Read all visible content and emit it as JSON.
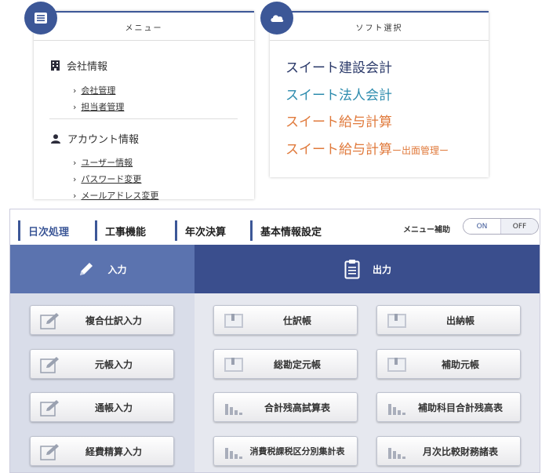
{
  "menu": {
    "title": "メニュー",
    "icon": "list-icon",
    "company": {
      "heading": "会社情報",
      "icon": "building-icon",
      "links": [
        "会社管理",
        "担当者管理"
      ]
    },
    "account": {
      "heading": "アカウント情報",
      "icon": "user-icon",
      "links": [
        "ユーザー情報",
        "パスワード変更",
        "メールアドレス変更"
      ]
    }
  },
  "software": {
    "title": "ソフト選択",
    "icon": "cloud-icon",
    "items": [
      {
        "label": "スイート建設会計",
        "suffix": "",
        "color": "#2b3a6a"
      },
      {
        "label": "スイート法人会計",
        "suffix": "",
        "color": "#2e8cae"
      },
      {
        "label": "スイート給与計算",
        "suffix": "",
        "color": "#e07a3c"
      },
      {
        "label": "スイート給与計算",
        "suffix": "ー出面管理ー",
        "color": "#e07a3c"
      }
    ]
  },
  "tabs": [
    {
      "label": "日次処理",
      "active": true
    },
    {
      "label": "工事機能",
      "active": false
    },
    {
      "label": "年次決算",
      "active": false
    },
    {
      "label": "基本情報設定",
      "active": false
    }
  ],
  "menu_assist": {
    "label": "メニュー補助",
    "on": "ON",
    "off": "OFF",
    "state": "ON"
  },
  "input_column": {
    "heading": "入力",
    "icon": "pencil-icon",
    "buttons": [
      "複合仕訳入力",
      "元帳入力",
      "通帳入力",
      "経費精算入力"
    ]
  },
  "output_column": {
    "heading": "出力",
    "icon": "clipboard-icon",
    "buttons": [
      {
        "label": "仕訳帳",
        "icon": "ledger-icon"
      },
      {
        "label": "出納帳",
        "icon": "ledger-icon"
      },
      {
        "label": "総勘定元帳",
        "icon": "ledger-icon"
      },
      {
        "label": "補助元帳",
        "icon": "ledger-icon"
      },
      {
        "label": "合計残高試算表",
        "icon": "bar-chart-icon"
      },
      {
        "label": "補助科目合計残高表",
        "icon": "bar-chart-icon"
      },
      {
        "label": "消費税課税区分別集計表",
        "icon": "bar-chart-icon"
      },
      {
        "label": "月次比較財務諸表",
        "icon": "bar-chart-icon"
      }
    ]
  }
}
